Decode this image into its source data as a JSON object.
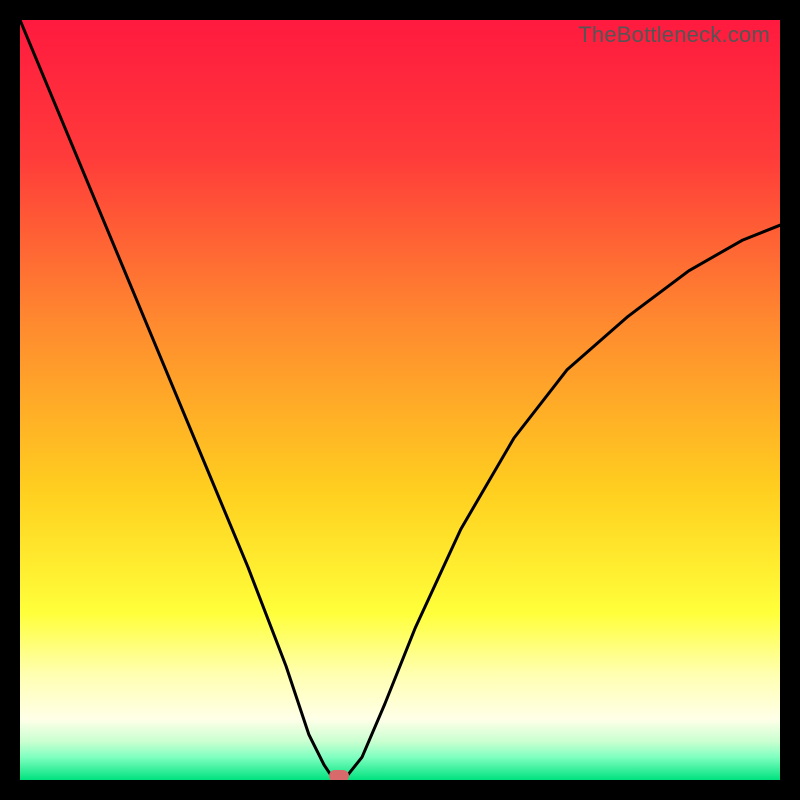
{
  "watermark": "TheBottleneck.com",
  "chart_data": {
    "type": "line",
    "title": "",
    "xlabel": "",
    "ylabel": "",
    "xlim": [
      0,
      100
    ],
    "ylim": [
      0,
      100
    ],
    "x": [
      0,
      5,
      10,
      15,
      20,
      25,
      30,
      35,
      38,
      40,
      41,
      42,
      43,
      45,
      48,
      52,
      58,
      65,
      72,
      80,
      88,
      95,
      100
    ],
    "values": [
      100,
      88,
      76,
      64,
      52,
      40,
      28,
      15,
      6,
      2,
      0.5,
      0,
      0.5,
      3,
      10,
      20,
      33,
      45,
      54,
      61,
      67,
      71,
      73
    ],
    "minimum_x": 42,
    "marker": {
      "x": 42,
      "y": 0,
      "color": "#d86a6c"
    },
    "gradient_stops": [
      {
        "pos": 0,
        "color": "#ff1a3f"
      },
      {
        "pos": 18,
        "color": "#ff3b3a"
      },
      {
        "pos": 40,
        "color": "#ff8a2f"
      },
      {
        "pos": 62,
        "color": "#ffcf1f"
      },
      {
        "pos": 78,
        "color": "#ffff3a"
      },
      {
        "pos": 86,
        "color": "#ffffb0"
      },
      {
        "pos": 92,
        "color": "#ffffe8"
      },
      {
        "pos": 95,
        "color": "#c8ffd0"
      },
      {
        "pos": 97,
        "color": "#7fffc0"
      },
      {
        "pos": 100,
        "color": "#00e27e"
      }
    ]
  }
}
